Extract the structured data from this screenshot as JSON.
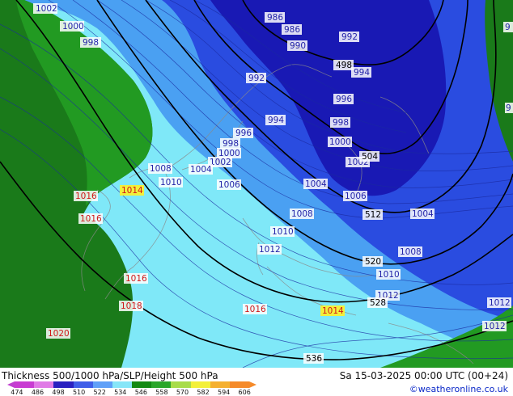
{
  "title": "Thickness 500/1000 hPa/SLP/Height 500 hPa",
  "datetime": "Sa 15-03-2025 00:00 UTC (00+24)",
  "credit": "©weatheronline.co.uk",
  "legend": {
    "ticks": [
      "474",
      "486",
      "498",
      "510",
      "522",
      "534",
      "546",
      "558",
      "570",
      "582",
      "594",
      "606"
    ],
    "colors": [
      "#c83cd2",
      "#e07ae6",
      "#2a20c0",
      "#3f5ee8",
      "#5fa0f8",
      "#87e6f8",
      "#138a13",
      "#2ba62b",
      "#a8dc4a",
      "#f3f03a",
      "#f5b030",
      "#f58a2a"
    ]
  },
  "colors": {
    "deep_blue": "#1919b4",
    "mid_blue": "#2a4ce0",
    "light_blue": "#4aa0f2",
    "cyan": "#7fe8f8",
    "dark_green": "#1a7a1a",
    "green": "#229a22",
    "label_slp_low": "#2424a8",
    "label_slp_high": "#d01818",
    "label_height": "#000000"
  },
  "map": {
    "slp_labels_low": [
      {
        "text": "1002"
      },
      {
        "text": "1000"
      },
      {
        "text": "998"
      },
      {
        "text": "986"
      },
      {
        "text": "986"
      },
      {
        "text": "990"
      },
      {
        "text": "992"
      },
      {
        "text": "994"
      },
      {
        "text": "992"
      },
      {
        "text": "994"
      },
      {
        "text": "996"
      },
      {
        "text": "998"
      },
      {
        "text": "996"
      },
      {
        "text": "998"
      },
      {
        "text": "1000"
      },
      {
        "text": "1002"
      },
      {
        "text": "1000"
      },
      {
        "text": "1002"
      },
      {
        "text": "1004"
      },
      {
        "text": "1006"
      },
      {
        "text": "1008"
      },
      {
        "text": "1010"
      },
      {
        "text": "1004"
      },
      {
        "text": "1006"
      },
      {
        "text": "1008"
      },
      {
        "text": "1010"
      },
      {
        "text": "1012"
      },
      {
        "text": "1004"
      },
      {
        "text": "1008"
      },
      {
        "text": "1010"
      },
      {
        "text": "1012"
      },
      {
        "text": "1014"
      },
      {
        "text": "1012"
      },
      {
        "text": "1012"
      },
      {
        "text": "9"
      },
      {
        "text": "9"
      }
    ],
    "slp_labels_high": [
      {
        "text": "1016"
      },
      {
        "text": "1014"
      },
      {
        "text": "1016"
      },
      {
        "text": "1016"
      },
      {
        "text": "1018"
      },
      {
        "text": "1020"
      },
      {
        "text": "1016"
      }
    ],
    "height_labels": [
      {
        "text": "498"
      },
      {
        "text": "504"
      },
      {
        "text": "512"
      },
      {
        "text": "520"
      },
      {
        "text": "528"
      },
      {
        "text": "536"
      }
    ]
  }
}
